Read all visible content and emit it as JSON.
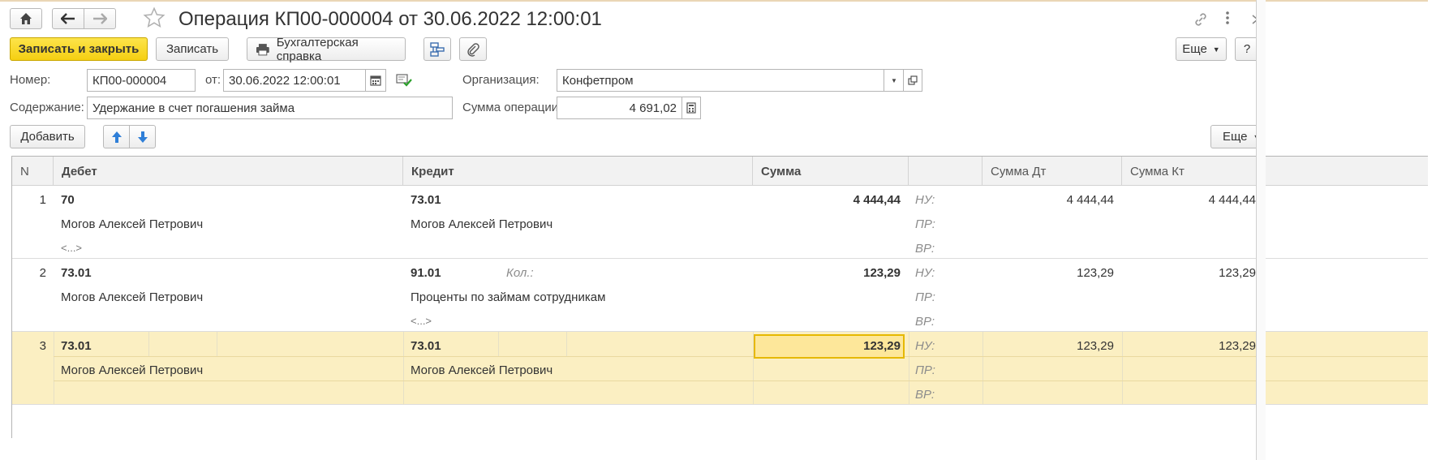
{
  "header": {
    "title": "Операция КП00-000004 от 30.06.2022 12:00:01"
  },
  "toolbar": {
    "save_close": "Записать и закрыть",
    "save": "Записать",
    "accounting_note": "Бухгалтерская справка",
    "more": "Еще",
    "help": "?"
  },
  "form": {
    "number_label": "Номер:",
    "number_value": "КП00-000004",
    "date_label": "от:",
    "date_value": "30.06.2022 12:00:01",
    "org_label": "Организация:",
    "org_value": "Конфетпром",
    "content_label": "Содержание:",
    "content_value": "Удержание в счет погашения займа",
    "amount_label": "Сумма операции:",
    "amount_value": "4 691,02"
  },
  "table_toolbar": {
    "add": "Добавить",
    "more": "Еще"
  },
  "table": {
    "columns": {
      "n": "N",
      "debit": "Дебет",
      "credit": "Кредит",
      "sum": "Сумма",
      "sum_dt": "Сумма Дт",
      "sum_kt": "Сумма Кт"
    },
    "labels": {
      "nu": "НУ:",
      "pr": "ПР:",
      "vr": "ВР:",
      "qty": "Кол.:",
      "empty": "<...>"
    },
    "rows": [
      {
        "n": "1",
        "debit_account": "70",
        "debit_sub1": "Могов Алексей Петрович",
        "debit_sub2": "<...>",
        "credit_account": "73.01",
        "credit_sub1": "Могов Алексей Петрович",
        "credit_sub2": "",
        "sum": "4 444,44",
        "sum_dt": "4 444,44",
        "sum_kt": "4 444,44"
      },
      {
        "n": "2",
        "debit_account": "73.01",
        "debit_sub1": "Могов Алексей Петрович",
        "debit_sub2": "",
        "credit_account": "91.01",
        "credit_sub1": "Проценты по займам сотрудникам",
        "credit_sub2": "<...>",
        "sum": "123,29",
        "sum_dt": "123,29",
        "sum_kt": "123,29"
      },
      {
        "n": "3",
        "debit_account": "73.01",
        "debit_sub1": "Могов Алексей Петрович",
        "debit_sub2": "",
        "credit_account": "73.01",
        "credit_sub1": "Могов Алексей Петрович",
        "credit_sub2": "",
        "sum": "123,29",
        "sum_dt": "123,29",
        "sum_kt": "123,29"
      }
    ]
  },
  "colors": {
    "primary_button": "#f5cf12",
    "selected_row": "#fbefc2",
    "focus_border": "#e6b800"
  }
}
